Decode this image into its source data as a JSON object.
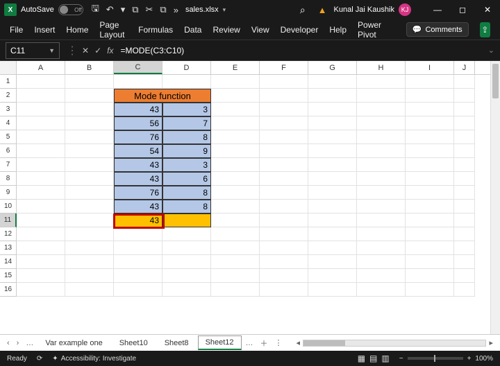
{
  "titlebar": {
    "autosave_label": "AutoSave",
    "autosave_state": "Off",
    "filename": "sales.xlsx ",
    "search_icon": "⌕",
    "user_name": "Kunal Jai Kaushik",
    "user_initials": "KJ"
  },
  "ribbon": {
    "tabs": [
      "File",
      "Insert",
      "Home",
      "Page Layout",
      "Formulas",
      "Data",
      "Review",
      "View",
      "Developer",
      "Help",
      "Power Pivot"
    ],
    "comments": "Comments"
  },
  "formula_bar": {
    "cell_ref": "C11",
    "formula": "=MODE(C3:C10)"
  },
  "columns": [
    "A",
    "B",
    "C",
    "D",
    "E",
    "F",
    "G",
    "H",
    "I",
    "J"
  ],
  "row_count": 16,
  "sheet_title": "Mode function",
  "chart_data": {
    "type": "table",
    "title": "Mode function",
    "columns": [
      "C",
      "D"
    ],
    "rows": [
      {
        "C": 43,
        "D": 3
      },
      {
        "C": 56,
        "D": 7
      },
      {
        "C": 76,
        "D": 8
      },
      {
        "C": 54,
        "D": 9
      },
      {
        "C": 43,
        "D": 3
      },
      {
        "C": 43,
        "D": 6
      },
      {
        "C": 76,
        "D": 8
      },
      {
        "C": 43,
        "D": 8
      }
    ],
    "result_cell": {
      "ref": "C11",
      "value": 43,
      "formula": "=MODE(C3:C10)"
    }
  },
  "sheets": {
    "tabs": [
      "Var example one",
      "Sheet10",
      "Sheet8",
      "Sheet12"
    ],
    "active": "Sheet12"
  },
  "status": {
    "ready": "Ready",
    "accessibility": "Accessibility: Investigate",
    "zoom": "100%"
  }
}
